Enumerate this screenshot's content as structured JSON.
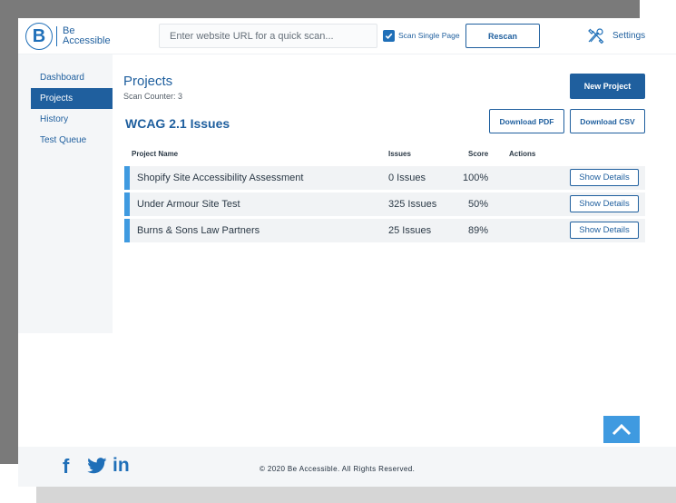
{
  "brand": {
    "name_line1": "Be",
    "name_line2": "Accessible",
    "logo_letter": "B"
  },
  "header": {
    "search_placeholder": "Enter website URL for a quick scan...",
    "scan_single_label": "Scan Single Page",
    "scan_single_checked": true,
    "rescan_label": "Rescan",
    "settings_label": "Settings"
  },
  "sidebar": {
    "items": [
      {
        "label": "Dashboard",
        "active": false
      },
      {
        "label": "Projects",
        "active": true
      },
      {
        "label": "History",
        "active": false
      },
      {
        "label": "Test Queue",
        "active": false
      }
    ]
  },
  "main": {
    "title": "Projects",
    "scan_counter": "Scan Counter: 3",
    "new_project_label": "New Project",
    "issues_heading": "WCAG 2.1 Issues",
    "download_pdf_label": "Download PDF",
    "download_csv_label": "Download CSV"
  },
  "table": {
    "headers": {
      "name": "Project Name",
      "issues": "Issues",
      "score": "Score",
      "actions": "Actions"
    },
    "rows": [
      {
        "name": "Shopify Site Accessibility Assessment",
        "issues": "0 Issues",
        "score": "100%",
        "action": "Show Details"
      },
      {
        "name": "Under Armour Site Test",
        "issues": "325 Issues",
        "score": "50%",
        "action": "Show Details"
      },
      {
        "name": "Burns & Sons Law Partners",
        "issues": "25 Issues",
        "score": "89%",
        "action": "Show Details"
      }
    ]
  },
  "footer": {
    "social_icons": [
      "facebook-icon",
      "twitter-icon",
      "linkedin-icon"
    ],
    "copyright": "© 2020 Be Accessible. All Rights Reserved."
  },
  "colors": {
    "primary": "#1f5f9e",
    "accent": "#3f9ae0",
    "panel": "#f4f6f8"
  }
}
